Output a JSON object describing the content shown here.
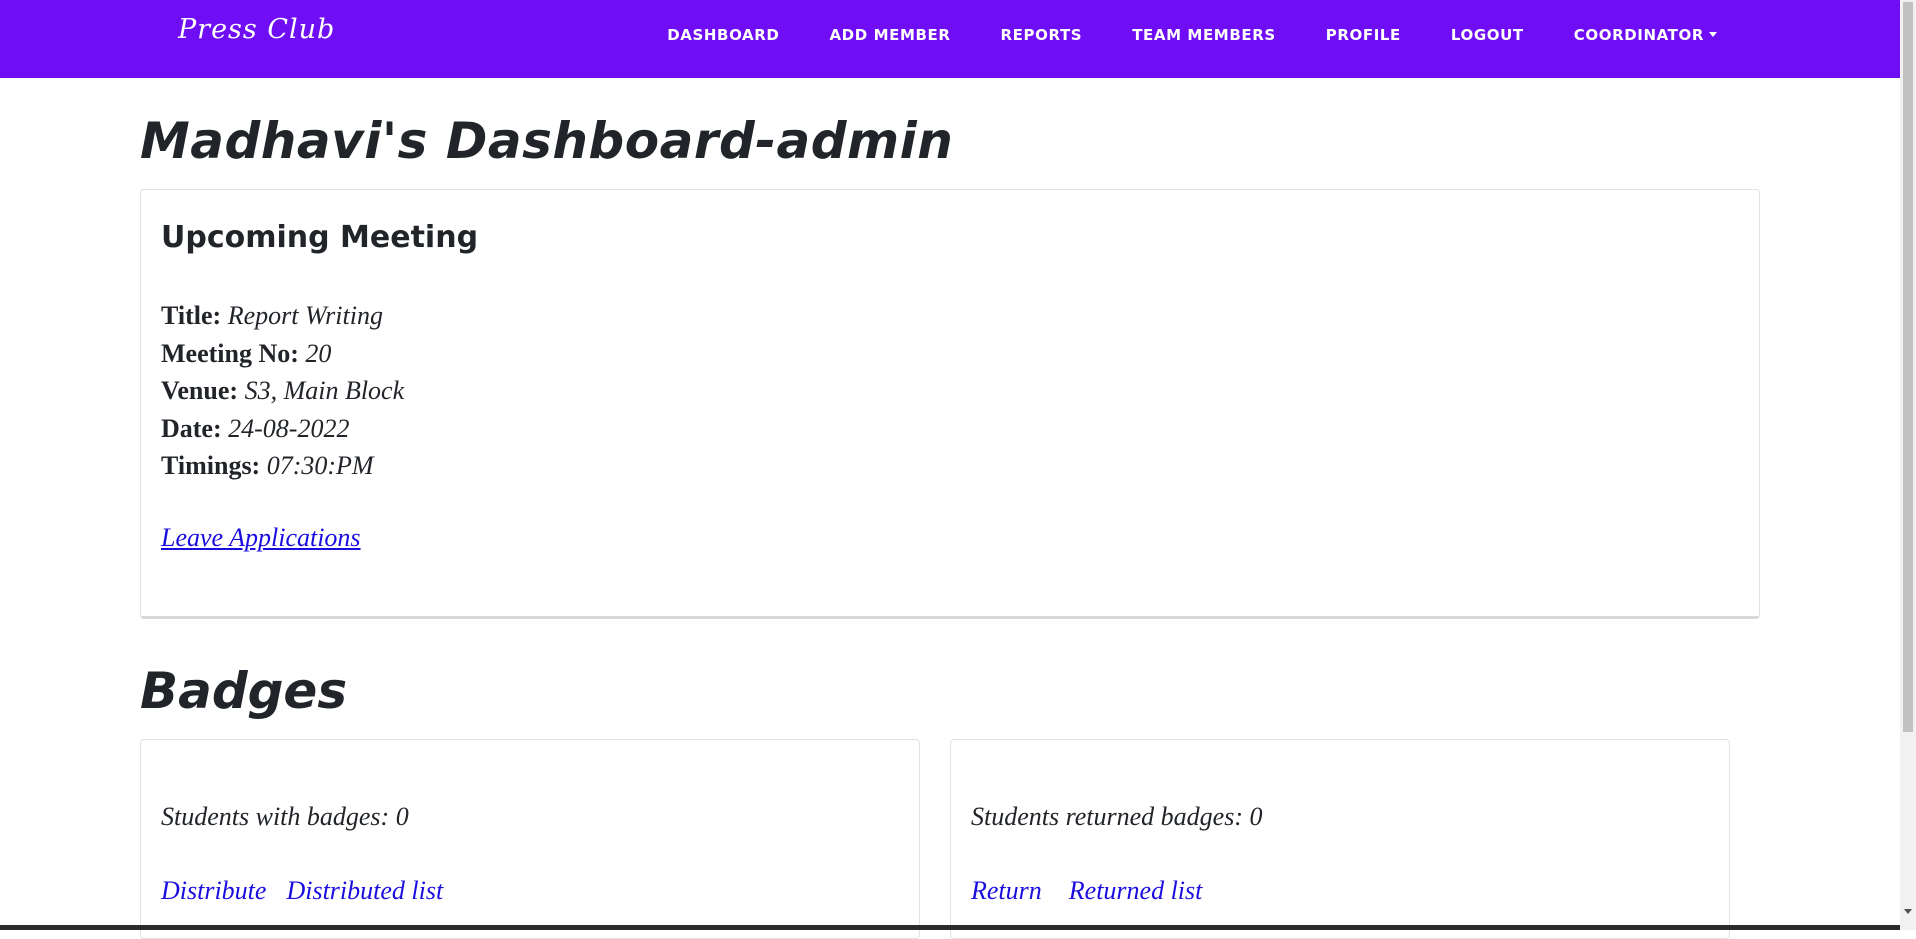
{
  "navbar": {
    "brand": "Press Club",
    "links": {
      "dashboard": "DASHBOARD",
      "add_member": "ADD MEMBER",
      "reports": "REPORTS",
      "team_members": "TEAM MEMBERS",
      "profile": "PROFILE",
      "logout": "LOGOUT",
      "coordinator": "COORDINATOR"
    },
    "background_color": "#6f0ef5"
  },
  "page_title": "Madhavi's Dashboard-admin",
  "meeting": {
    "heading": "Upcoming Meeting",
    "title_label": "Title:",
    "title_value": "Report Writing",
    "number_label": "Meeting No:",
    "number_value": "20",
    "venue_label": "Venue:",
    "venue_value": "S3, Main Block",
    "date_label": "Date:",
    "date_value": "24-08-2022",
    "timings_label": "Timings:",
    "timings_value": "07:30:PM",
    "leave_link": "Leave Applications"
  },
  "badges": {
    "heading": "Badges",
    "with_badges_text": "Students with badges: 0",
    "distribute_link": "Distribute",
    "distributed_list_link": "Distributed list",
    "returned_text": "Students returned badges: 0",
    "return_link": "Return",
    "returned_list_link": "Returned list"
  },
  "colors": {
    "link": "#1a0dde",
    "text": "#212529"
  }
}
